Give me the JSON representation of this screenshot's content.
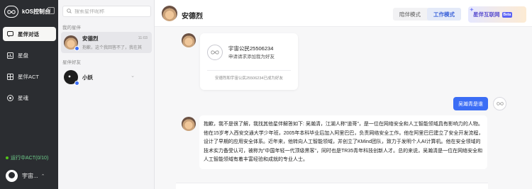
{
  "app": {
    "title": "kOS控制台"
  },
  "sidebar": {
    "items": [
      {
        "label": "星伴对话",
        "icon": "chat-bubble-icon",
        "active": true
      },
      {
        "label": "星盘",
        "icon": "chart-icon",
        "active": false
      },
      {
        "label": "星伴ACT",
        "icon": "grid-icon",
        "active": false
      },
      {
        "label": "星魂",
        "icon": "soul-icon",
        "active": false
      }
    ],
    "status": "运行中ACT(0/10)",
    "user": {
      "name": "宇宙..."
    }
  },
  "contacts": {
    "search_placeholder": "搜索星伴昵称",
    "sections": [
      {
        "label": "我的星伴",
        "items": [
          {
            "name": "安德烈",
            "time": "11:03",
            "preview": "抱歉，这个我回答不了，我在其"
          }
        ]
      },
      {
        "label": "星伴好友",
        "items": [
          {
            "name": "小妖",
            "time": "",
            "preview": ""
          }
        ]
      }
    ]
  },
  "chat": {
    "title": "安德烈",
    "modes": [
      {
        "label": "陪伴模式",
        "active": false
      },
      {
        "label": "工作模式",
        "active": true
      }
    ],
    "network_button": {
      "label": "星伴互联网",
      "badge": "Beta"
    },
    "friend_card": {
      "name": "宇宙公民25506234",
      "subtitle": "申请请求添加我为好友",
      "footer": "安德烈和宇宙公民25506234已成为好友"
    },
    "outgoing_message": "吴瀚青是谁",
    "reply": "抱歉，我不是很了解，我找其他星伴解答如下: 吴瀚清，江湖人称\"道哥\"，是一位在网络安全和人工智能领域具有影响力的人物。他在15岁考入西安交通大学少年班，2005年本科毕业后加入阿里巴巴，负责网络安全工作。他在阿里巴巴建立了安全开发流程，设计了早期的应用安全体系。近年来，他转向人工智能领域，并创立了KMind团队，致力于发明个人AI计算机。他在安全领域的技术实力备受认可，被称为\"中国年轻一代顶级黑客\"，同时也是TR35青年科技创新人才。总的来说，吴瀚清是一位在网络安全和人工智能领域有着丰富经验和成就的专业人士。"
  },
  "colors": {
    "sidebar_bg": "#2b2d31",
    "accent": "#3b6df5",
    "status_green": "#52c41a"
  }
}
